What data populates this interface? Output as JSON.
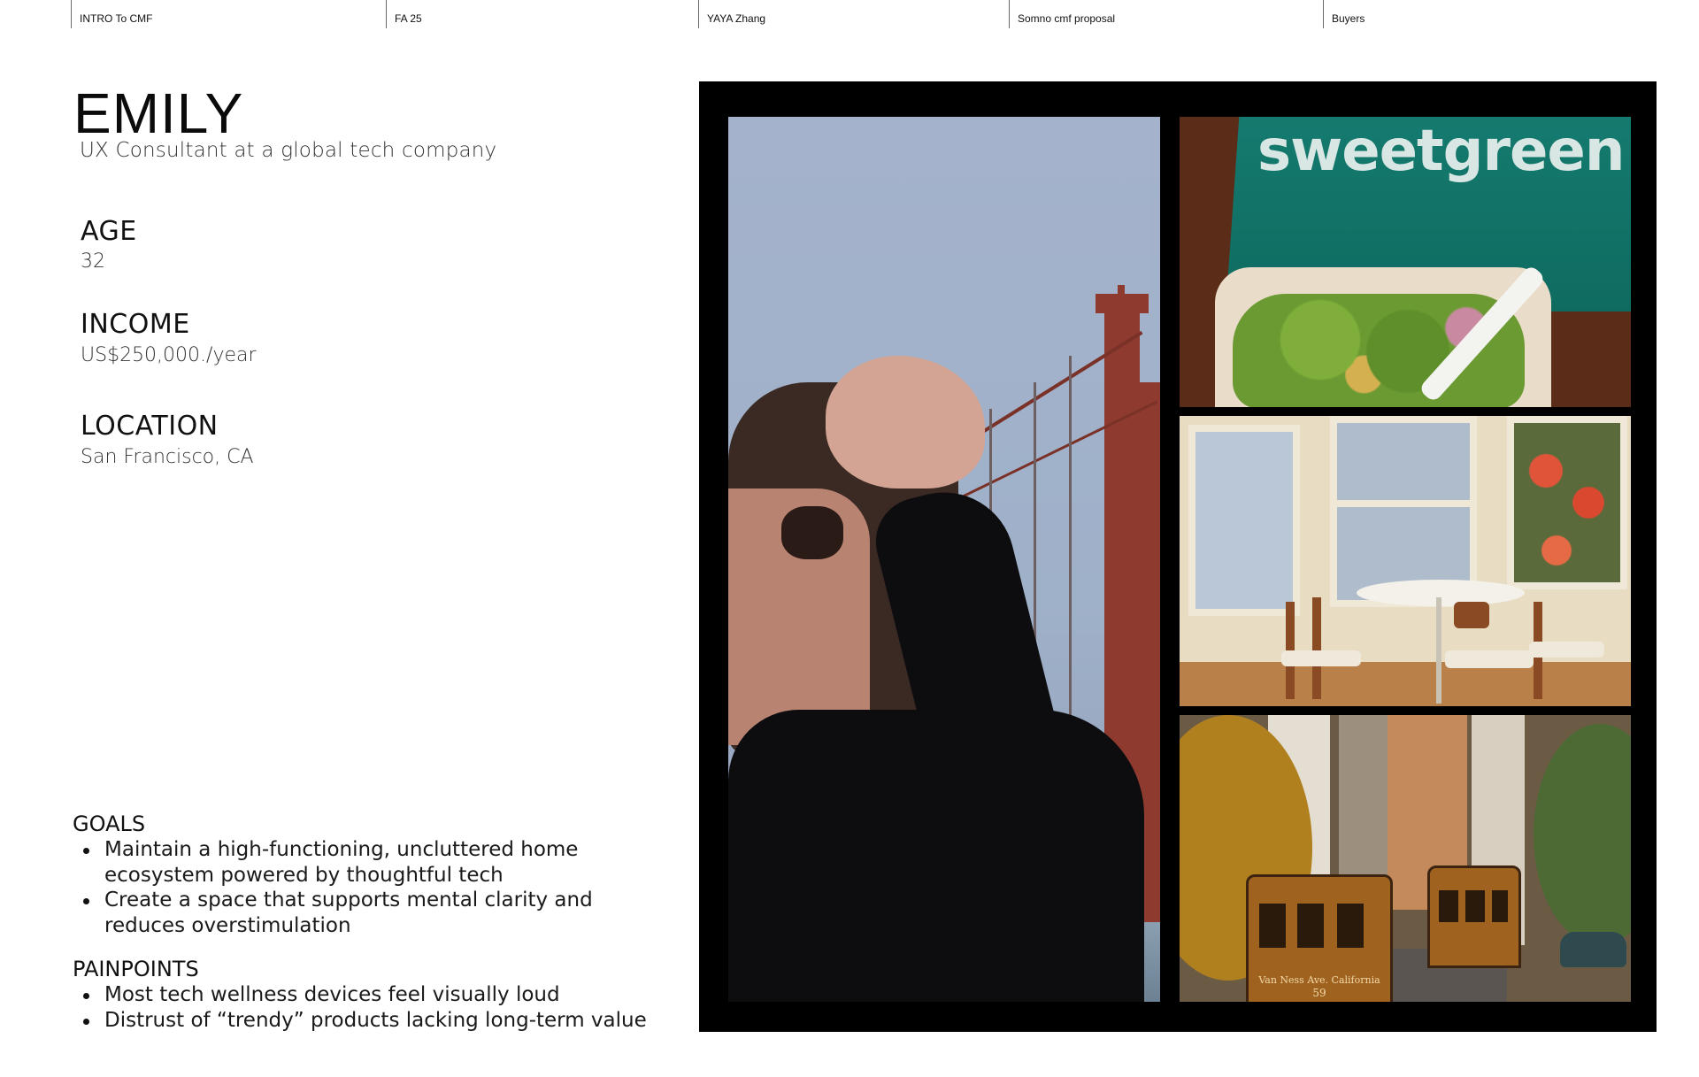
{
  "header": {
    "cells": [
      "INTRO To CMF",
      "FA 25",
      "YAYA Zhang",
      "Somno cmf proposal",
      "Buyers"
    ]
  },
  "persona": {
    "name": "EMILY",
    "role": "UX Consultant at a global tech company",
    "age_label": "AGE",
    "age_value": "32",
    "income_label": "INCOME",
    "income_value": "US$250,000./year",
    "location_label": "LOCATION",
    "location_value": "San Francisco, CA"
  },
  "goals": {
    "title": "GOALS",
    "items": [
      "Maintain a high-functioning, uncluttered home ecosystem powered by thoughtful tech",
      "Create a space that supports mental clarity and reduces overstimulation"
    ]
  },
  "painpoints": {
    "title": "PAINPOINTS",
    "items": [
      "Most tech wellness devices feel visually loud",
      "Distrust of “trendy” products lacking long-term value"
    ]
  },
  "collage": {
    "salad_bag_text": "sweetgreen",
    "cable_car_sign": "Van Ness Ave. California",
    "cable_car_number": "59"
  },
  "colors": {
    "collage_frame": "#000000",
    "sweetgreen_bag": "#157b70",
    "bridge_red": "#8e3a2e"
  }
}
